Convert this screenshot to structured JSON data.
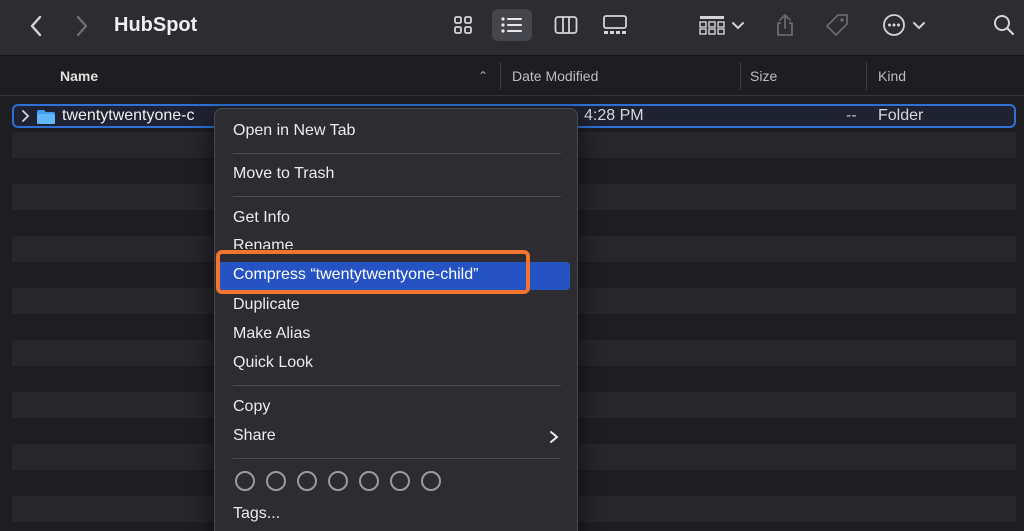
{
  "toolbar": {
    "title": "HubSpot",
    "back_icon": "chevron-left-icon",
    "forward_icon": "chevron-right-icon",
    "view_modes": [
      "icons",
      "list",
      "columns",
      "gallery"
    ],
    "active_view": "list"
  },
  "columns": {
    "name": "Name",
    "date_modified": "Date Modified",
    "size": "Size",
    "kind": "Kind"
  },
  "selected_item": {
    "name": "twentytwentyone-c",
    "date": "4:28 PM",
    "size": "--",
    "kind": "Folder"
  },
  "context_menu": {
    "open_new_tab": "Open in New Tab",
    "move_to_trash": "Move to Trash",
    "get_info": "Get Info",
    "rename": "Rename",
    "compress": "Compress “twentytwentyone-child”",
    "duplicate": "Duplicate",
    "make_alias": "Make Alias",
    "quick_look": "Quick Look",
    "copy": "Copy",
    "share": "Share",
    "tags": "Tags..."
  },
  "colors": {
    "accent": "#2553c4",
    "highlight_outline": "#f2742f",
    "selection_border": "#2f6fd6"
  }
}
